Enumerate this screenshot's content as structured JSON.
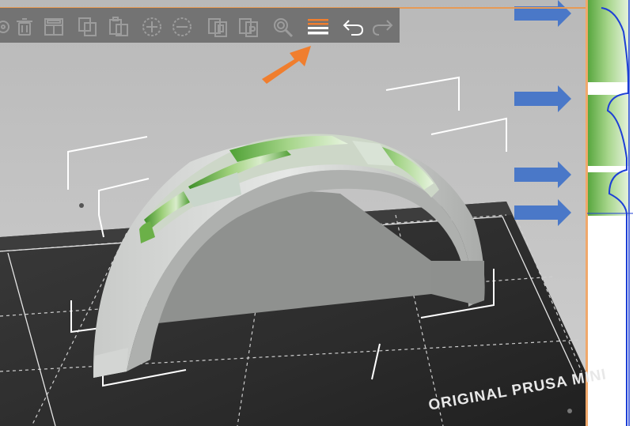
{
  "toolbar": {
    "tools": [
      {
        "name": "layers-editor-icon"
      },
      {
        "name": "delete-icon"
      },
      {
        "name": "arrange-icon"
      },
      {
        "name": "copy-icon"
      },
      {
        "name": "paste-icon"
      },
      {
        "name": "add-instance-icon"
      },
      {
        "name": "remove-instance-icon"
      },
      {
        "name": "split-objects-icon"
      },
      {
        "name": "split-parts-icon"
      },
      {
        "name": "search-icon"
      },
      {
        "name": "variable-layer-height-icon",
        "active": true
      },
      {
        "name": "undo-icon"
      },
      {
        "name": "redo-icon"
      }
    ]
  },
  "bed": {
    "label": "ORIGINAL PRUSA MINI"
  },
  "colors": {
    "accent_orange": "#f07e2e",
    "arrow_blue": "#4a78c8",
    "bed": "#2e2e2e",
    "model_gray": "#9a9c9a",
    "layer_green": "#5aa63a",
    "toolbar_bg": "#6a6a6a"
  }
}
